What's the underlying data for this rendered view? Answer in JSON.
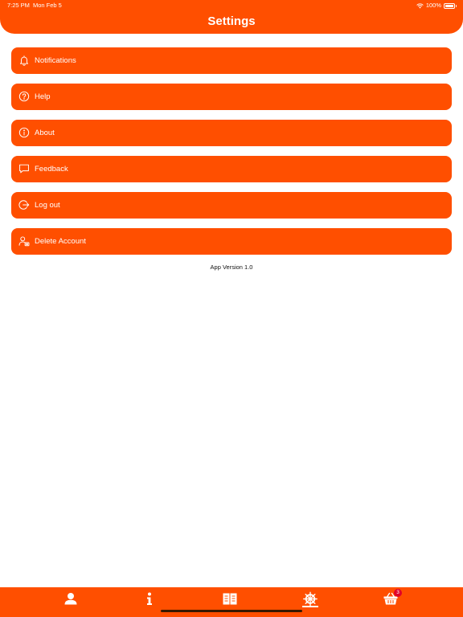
{
  "status_bar": {
    "time": "7:25 PM",
    "date": "Mon Feb 5",
    "battery": "100%"
  },
  "header": {
    "title": "Settings"
  },
  "menu": {
    "items": [
      {
        "label": "Notifications",
        "icon": "bell-icon"
      },
      {
        "label": "Help",
        "icon": "question-circle-icon"
      },
      {
        "label": "About",
        "icon": "info-circle-icon"
      },
      {
        "label": "Feedback",
        "icon": "chat-bubble-icon"
      },
      {
        "label": "Log out",
        "icon": "logout-icon"
      },
      {
        "label": "Delete Account",
        "icon": "user-delete-icon"
      }
    ]
  },
  "footer": {
    "app_version": "App Version 1.0"
  },
  "tab_bar": {
    "tabs": [
      {
        "icon": "person-icon"
      },
      {
        "icon": "info-icon"
      },
      {
        "icon": "book-icon"
      },
      {
        "icon": "ship-wheel-icon",
        "active": true
      },
      {
        "icon": "basket-icon",
        "badge": "3"
      }
    ]
  },
  "colors": {
    "accent": "#ff4f00",
    "badge": "#e0002a",
    "text_light": "#ffffff"
  }
}
